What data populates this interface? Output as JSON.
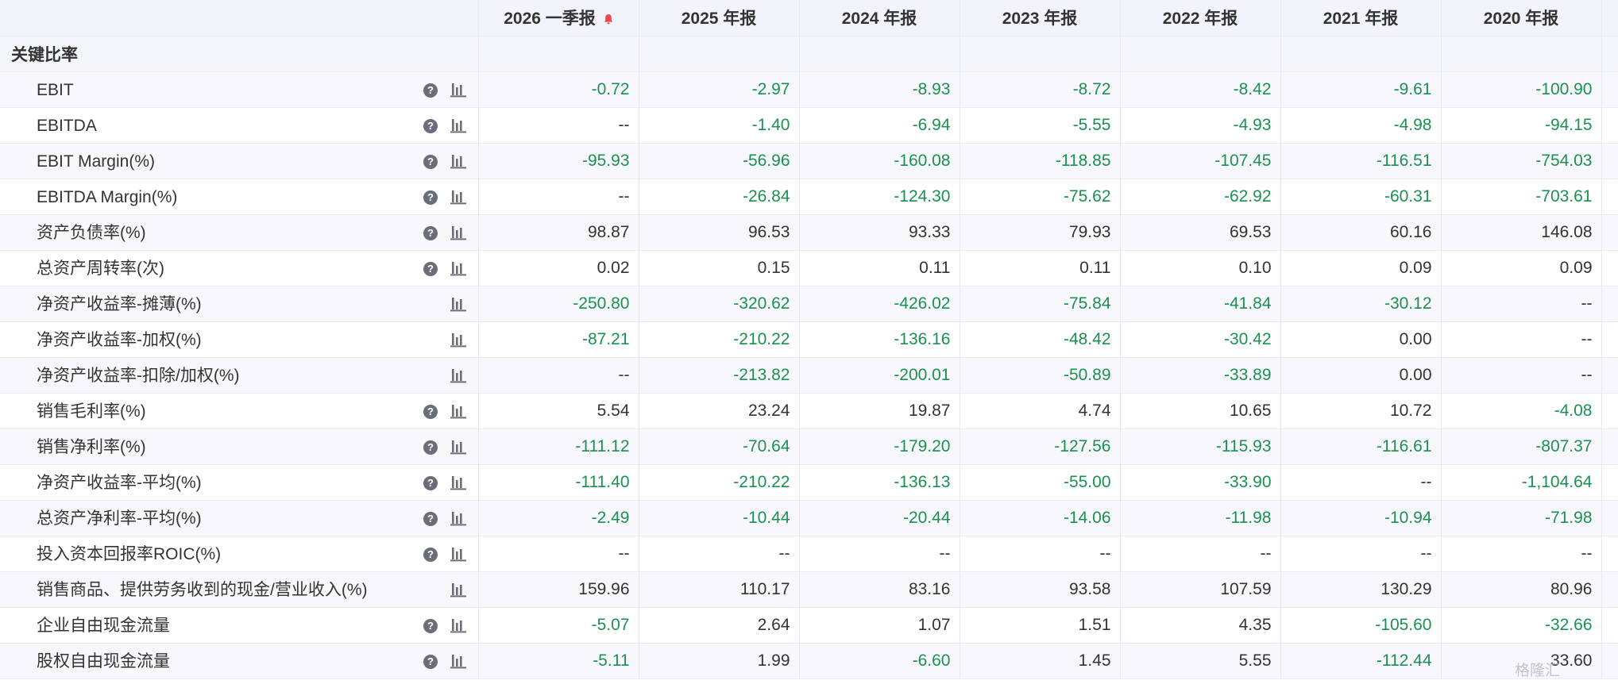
{
  "columns": [
    "2026 一季报",
    "2025 年报",
    "2024 年报",
    "2023 年报",
    "2022 年报",
    "2021 年报",
    "2020 年报"
  ],
  "section_title": "关键比率",
  "colors": {
    "negative": "#1b9150",
    "text": "#333333",
    "header_bg": "#f3f4fb"
  },
  "icons": {
    "bell": "bell-icon",
    "help": "question-icon",
    "chart": "bar-chart-icon"
  },
  "rows": [
    {
      "label": "EBIT",
      "help": true,
      "values": [
        "-0.72",
        "-2.97",
        "-8.93",
        "-8.72",
        "-8.42",
        "-9.61",
        "-100.90"
      ]
    },
    {
      "label": "EBITDA",
      "help": true,
      "values": [
        "--",
        "-1.40",
        "-6.94",
        "-5.55",
        "-4.93",
        "-4.98",
        "-94.15"
      ]
    },
    {
      "label": "EBIT Margin(%)",
      "help": true,
      "values": [
        "-95.93",
        "-56.96",
        "-160.08",
        "-118.85",
        "-107.45",
        "-116.51",
        "-754.03"
      ]
    },
    {
      "label": "EBITDA Margin(%)",
      "help": true,
      "values": [
        "--",
        "-26.84",
        "-124.30",
        "-75.62",
        "-62.92",
        "-60.31",
        "-703.61"
      ]
    },
    {
      "label": "资产负债率(%)",
      "help": true,
      "values": [
        "98.87",
        "96.53",
        "93.33",
        "79.93",
        "69.53",
        "60.16",
        "146.08"
      ]
    },
    {
      "label": "总资产周转率(次)",
      "help": true,
      "values": [
        "0.02",
        "0.15",
        "0.11",
        "0.11",
        "0.10",
        "0.09",
        "0.09"
      ]
    },
    {
      "label": "净资产收益率-摊薄(%)",
      "help": false,
      "values": [
        "-250.80",
        "-320.62",
        "-426.02",
        "-75.84",
        "-41.84",
        "-30.12",
        "--"
      ]
    },
    {
      "label": "净资产收益率-加权(%)",
      "help": false,
      "values": [
        "-87.21",
        "-210.22",
        "-136.16",
        "-48.42",
        "-30.42",
        "0.00",
        "--"
      ]
    },
    {
      "label": "净资产收益率-扣除/加权(%)",
      "help": false,
      "values": [
        "--",
        "-213.82",
        "-200.01",
        "-50.89",
        "-33.89",
        "0.00",
        "--"
      ]
    },
    {
      "label": "销售毛利率(%)",
      "help": true,
      "values": [
        "5.54",
        "23.24",
        "19.87",
        "4.74",
        "10.65",
        "10.72",
        "-4.08"
      ]
    },
    {
      "label": "销售净利率(%)",
      "help": true,
      "values": [
        "-111.12",
        "-70.64",
        "-179.20",
        "-127.56",
        "-115.93",
        "-116.61",
        "-807.37"
      ]
    },
    {
      "label": "净资产收益率-平均(%)",
      "help": true,
      "values": [
        "-111.40",
        "-210.22",
        "-136.13",
        "-55.00",
        "-33.90",
        "--",
        "-1,104.64"
      ]
    },
    {
      "label": "总资产净利率-平均(%)",
      "help": true,
      "values": [
        "-2.49",
        "-10.44",
        "-20.44",
        "-14.06",
        "-11.98",
        "-10.94",
        "-71.98"
      ]
    },
    {
      "label": "投入资本回报率ROIC(%)",
      "help": true,
      "values": [
        "--",
        "--",
        "--",
        "--",
        "--",
        "--",
        "--"
      ]
    },
    {
      "label": "销售商品、提供劳务收到的现金/营业收入(%)",
      "help": false,
      "values": [
        "159.96",
        "110.17",
        "83.16",
        "93.58",
        "107.59",
        "130.29",
        "80.96"
      ]
    },
    {
      "label": "企业自由现金流量",
      "help": true,
      "values": [
        "-5.07",
        "2.64",
        "1.07",
        "1.51",
        "4.35",
        "-105.60",
        "-32.66"
      ]
    },
    {
      "label": "股权自由现金流量",
      "help": true,
      "values": [
        "-5.11",
        "1.99",
        "-6.60",
        "1.45",
        "5.55",
        "-112.44",
        "33.60"
      ]
    }
  ],
  "watermark": "格隆汇"
}
